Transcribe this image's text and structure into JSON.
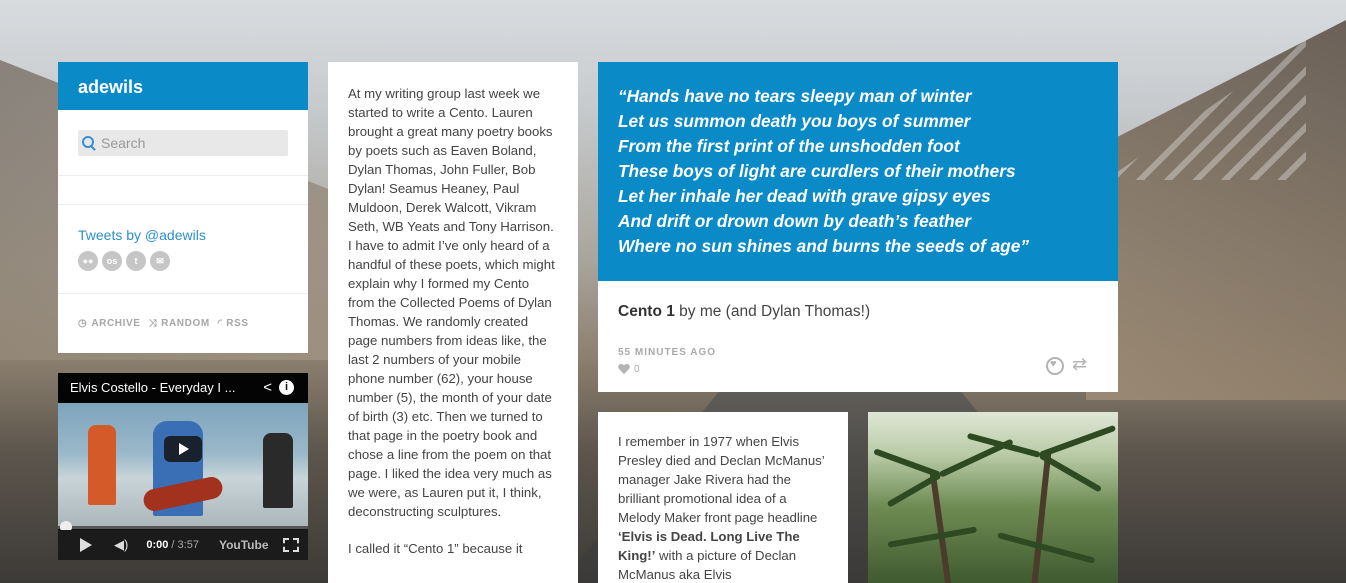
{
  "blog": {
    "title": "adewils"
  },
  "search": {
    "placeholder": "Search"
  },
  "sidebar": {
    "tweets_label": "Tweets by @adewils",
    "social_icons": [
      "flickr-icon",
      "lastfm-icon",
      "twitter-icon",
      "mail-icon"
    ],
    "social_labels": [
      "●●",
      "os",
      "t",
      "✉"
    ],
    "links": [
      {
        "icon": "clock-icon",
        "label": "ARCHIVE"
      },
      {
        "icon": "shuffle-icon",
        "label": "RANDOM"
      },
      {
        "icon": "rss-icon",
        "label": "RSS"
      }
    ]
  },
  "video": {
    "title": "Elvis Costello - Everyday I ...",
    "current_time": "0:00",
    "duration": "/ 3:57",
    "brand": "YouTube",
    "progress": 0
  },
  "text_post": {
    "paragraph1": "At my writing group last week we started to write a Cento. Lauren brought a great many poetry books by poets such as Eaven Boland, Dylan Thomas, John Fuller, Bob Dylan! Seamus Heaney, Paul Muldoon, Derek Walcott, Vikram Seth, WB Yeats and Tony Harrison. I have to admit I’ve only heard of a handful of these poets, which might explain why I formed my Cento from the Collected Poems of Dylan Thomas. We randomly created page numbers from ideas like, the last 2 numbers of your mobile phone number (62), your house number (5), the month of your date of birth (3) etc. Then we turned to that page in the poetry book and chose a line from the poem on that page. I liked the idea very much as we were, as Lauren put it, I think, deconstructing sculptures.",
    "paragraph2": "I called it “Cento 1” because it"
  },
  "quote_post": {
    "lines": [
      "“Hands have no tears sleepy man of winter",
      "Let us summon death you boys of summer",
      "From the first print of the unshodden foot",
      "These boys of light are curdlers of their mothers",
      "Let her inhale her dead with grave gipsy eyes",
      "And drift or drown down by death’s feather",
      "Where no sun shines and burns the seeds of age”"
    ],
    "source_title": "Cento 1",
    "source_rest": " by me (and Dylan Thomas!)",
    "timestamp": "55 MINUTES AGO",
    "like_count": "0"
  },
  "elvis_post": {
    "text_a": "I remember in 1977 when Elvis Presley died and Declan McManus’ manager Jake Rivera had the brilliant promotional idea of a Melody Maker front page headline ",
    "text_bold": "‘Elvis is Dead.  Long Live The King!’",
    "text_b": " with a picture of Declan McManus aka Elvis"
  },
  "colors": {
    "accent": "#0b8ac8",
    "link": "#2c8fc9"
  }
}
